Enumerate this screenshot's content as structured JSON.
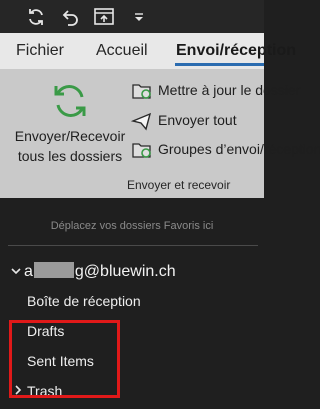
{
  "qat": {
    "icons": [
      "sync-icon",
      "undo-icon",
      "touch-mode-icon",
      "customize-dropdown-icon"
    ]
  },
  "tabs": [
    {
      "label": "Fichier"
    },
    {
      "label": "Accueil"
    },
    {
      "label": "Envoi/réception"
    }
  ],
  "ribbon": {
    "send_receive_all": "Envoyer/Recevoir tous les dossiers",
    "update_folder": "Mettre à jour le dossier",
    "send_all": "Envoyer tout",
    "send_receive_groups": "Groupes d’envoi/réception",
    "group_label": "Envoyer et recevoir"
  },
  "folder_pane": {
    "favorites_hint": "Déplacez vos dossiers Favoris ici",
    "account_prefix": "a",
    "account_suffix": "g@bluewin.ch",
    "folders": [
      {
        "label": "Boîte de réception"
      },
      {
        "label": "Drafts"
      },
      {
        "label": "Sent Items"
      },
      {
        "label": "Trash"
      }
    ]
  },
  "colors": {
    "highlight": "#e01919",
    "accent": "#2b6cb0",
    "sync_green": "#3a9a47"
  }
}
